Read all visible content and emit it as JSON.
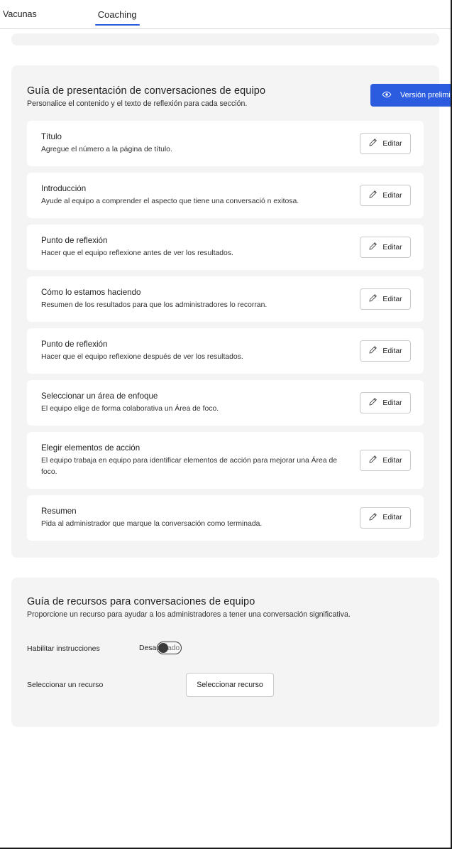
{
  "tabs": [
    {
      "label": "Vacunas",
      "active": false
    },
    {
      "label": "Coaching",
      "active": true
    }
  ],
  "presentation_panel": {
    "title": "Guía de presentación de conversaciones de equipo",
    "subtitle": "Personalice el contenido y el texto de reflexión para cada sección.",
    "preview_button": {
      "label": "Versión preliminar",
      "icon": "eye-icon",
      "color": "#2b5ce0",
      "text_color": "#ffffff"
    },
    "edit_button_label": "Editar",
    "edit_button_icon": "pencil-icon",
    "sections": [
      {
        "title": "Título",
        "description": "Agregue el número a la página de título."
      },
      {
        "title": "Introducción",
        "description": "Ayude al equipo a comprender el aspecto que tiene una conversació n exitosa."
      },
      {
        "title": "Punto de reflexión",
        "description": "Hacer que el equipo reflexione antes de ver los resultados."
      },
      {
        "title": "Cómo lo estamos haciendo",
        "description": "Resumen de los resultados para que los administradores lo recorran."
      },
      {
        "title": "Punto de reflexión",
        "description": "Hacer que el equipo reflexione después de ver los resultados."
      },
      {
        "title": "Seleccionar un área de enfoque",
        "description": "El equipo elige de forma colaborativa un Área de foco."
      },
      {
        "title": "Elegir elementos de acción",
        "description": "El equipo trabaja en equipo para identificar elementos de acción para mejorar una Área de foco."
      },
      {
        "title": "Resumen",
        "description": "Pida al administrador que marque la conversación como terminada."
      }
    ]
  },
  "resource_panel": {
    "title": "Guía de recursos para conversaciones de equipo",
    "subtitle": "Proporcione un recurso para ayudar a los administradores a tener una conversación significativa.",
    "enable_instructions": {
      "label": "Habilitar instrucciones",
      "state_text": "Desactivado",
      "state": "off"
    },
    "select_resource": {
      "label": "Seleccionar un recurso",
      "button_label": "Seleccionar recurso"
    }
  }
}
